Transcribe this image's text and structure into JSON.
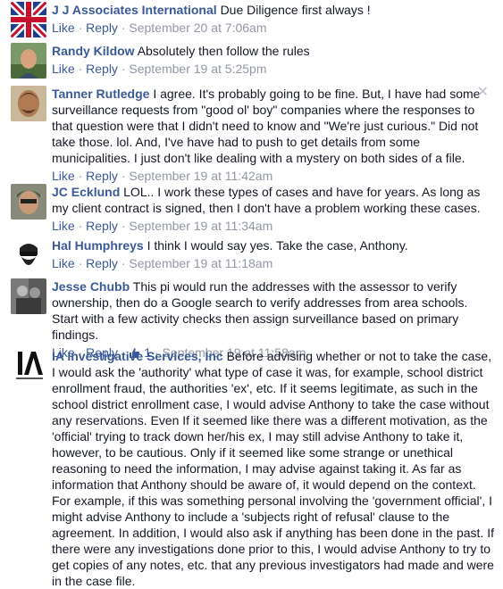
{
  "actions": {
    "like": "Like",
    "reply": "Reply",
    "sep": " · "
  },
  "close_symbol": "✕",
  "comments": [
    {
      "author": "J J Associates International",
      "text": "Due Diligence first always !",
      "time": "September 20 at 7:06am"
    },
    {
      "author": "Randy Kildow",
      "text": "Absolutely then follow the rules",
      "time": "September 19 at 5:25pm"
    },
    {
      "author": "Tanner Rutledge",
      "text": "I agree. It's probably going to be fine. But, I have had some surveillance requests from \"good ol' boy\" companies where the responses to that question were that I didn't need to know and \"We're just curious.\" Did not take those. lol. And, I've have had to push to get details from some municipalities. I just don't like dealing with a mystery on both sides of a file.",
      "time": "September 19 at 11:42am"
    },
    {
      "author": "JC Ecklund",
      "text": "LOL.. I work these types of cases and have for years. As long as my client contract is signed, then I don't have a problem working these cases.",
      "time": "September 19 at 11:34am"
    },
    {
      "author": "Hal Humphreys",
      "text": "I think I would say yes. Take the case, Anthony.",
      "time": "September 19 at 11:18am"
    },
    {
      "author": "Jesse Chubb",
      "text": "This pi would run the addresses with the assessor to verify ownership, then do a Google search to verify addresses from area schools. Start with a few activity checks then assign surveillance based on primary findings.",
      "time": "September 19 at 11:58am",
      "like_count": "1"
    },
    {
      "author": "IA Investigative Services, Inc",
      "text": "Before advising whether or not to take the case, I would ask the 'authority' what type of case it was, for example, school district enrollment fraud, the authorities 'ex', etc. If it seems legitimate, as such in the school district enrollment case, I would advise Anthony to take the case without any reservations. Even If it seemed like there was a different motivation, as the 'official' trying to track down her/his ex, I may still advise Anthony to take it, however, to be cautious. Only if it seemed like some strange or unethical reasoning to need the information, I may advise against taking it. As far as information that Anthony should be aware of, it would depend on the context. For example, if this was something personal involving the 'government official', I might advise Anthony to include a 'subjects right of refusal' clause to the agreement. In addition, I would also ask if anything has been done in the past. If there were any investigations done prior to this, I would advise Anthony to try to get copies of any notes, etc. that any previous investigators had made and were in the case file."
    }
  ]
}
